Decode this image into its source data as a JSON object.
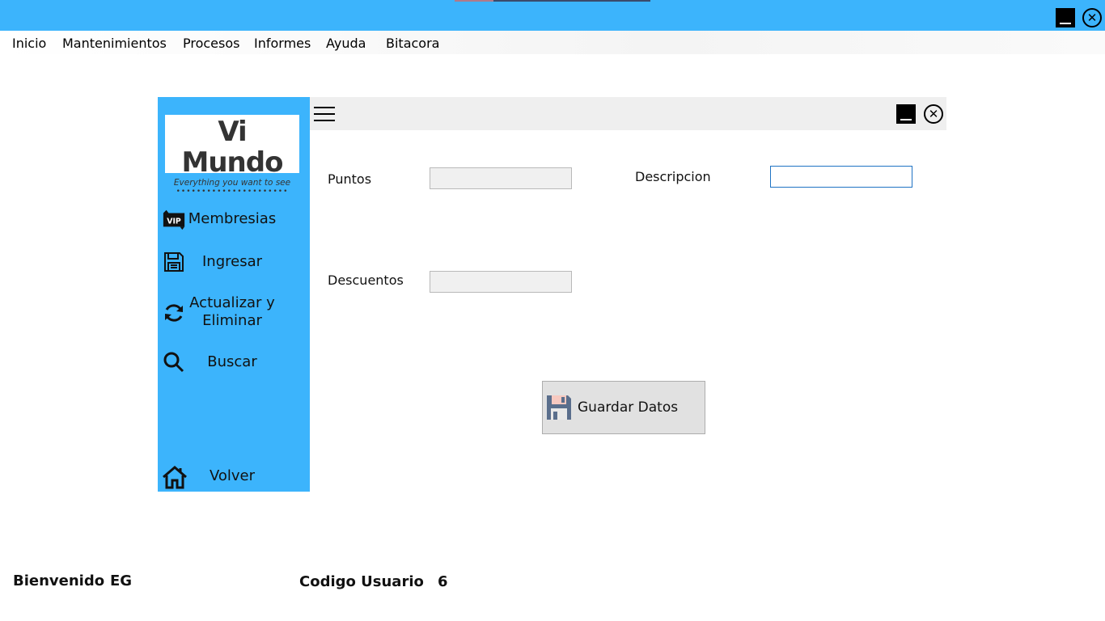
{
  "window": {
    "minimize_icon": "minimize-icon",
    "close_icon": "close-icon",
    "accent_color": "#3cb4fc"
  },
  "menu": {
    "items": [
      "Inicio",
      "Mantenimientos",
      "Procesos",
      "Informes",
      "Ayuda",
      "Bitacora"
    ]
  },
  "sidebar": {
    "logo": {
      "title": "Vi Mundo",
      "tagline": "Everything you want to see"
    },
    "items": [
      {
        "label": "Membresias",
        "icon": "vip-icon"
      },
      {
        "label": "Ingresar",
        "icon": "floppy-disk-icon"
      },
      {
        "label": "Actualizar y Eliminar",
        "icon": "refresh-icon"
      },
      {
        "label": "Buscar",
        "icon": "search-icon"
      },
      {
        "label": "Volver",
        "icon": "home-icon"
      }
    ]
  },
  "form": {
    "menu_icon": "hamburger-icon",
    "fields": {
      "puntos": {
        "label": "Puntos",
        "value": ""
      },
      "descripcion": {
        "label": "Descripcion",
        "value": ""
      },
      "descuentos": {
        "label": "Descuentos",
        "value": ""
      }
    },
    "save_button": {
      "label": "Guardar Datos",
      "icon": "floppy-disk-icon"
    }
  },
  "status": {
    "welcome_label": "Bienvenido",
    "welcome_user": "EG",
    "user_code_label": "Codigo Usuario",
    "user_code_value": "6"
  }
}
